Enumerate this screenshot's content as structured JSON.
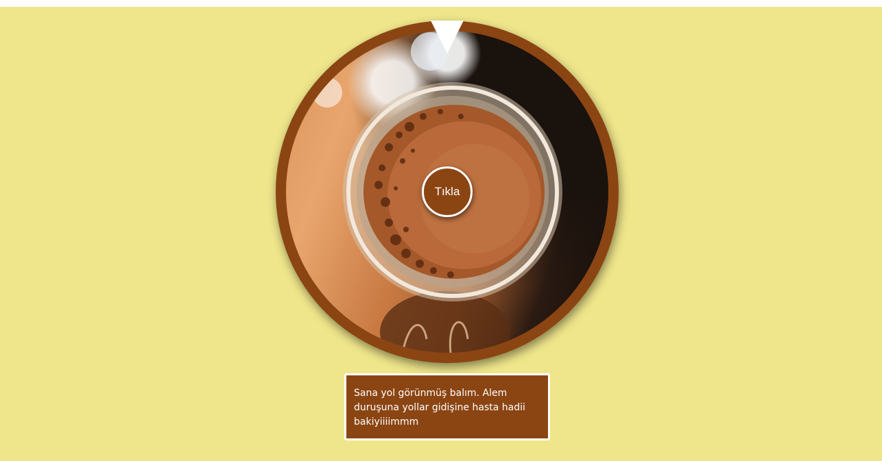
{
  "wheel": {
    "image_description_icon": "coffee-cup-image",
    "colors": {
      "background": "#efe68b",
      "accent": "#8b4513",
      "pointer": "#ffffff"
    }
  },
  "spin_button": {
    "label": "Tıkla"
  },
  "fortune": {
    "text": "Sana yol görünmüş balım. Alem duruşuna yollar gidişine hasta hadii bakiyiiiimmm"
  }
}
